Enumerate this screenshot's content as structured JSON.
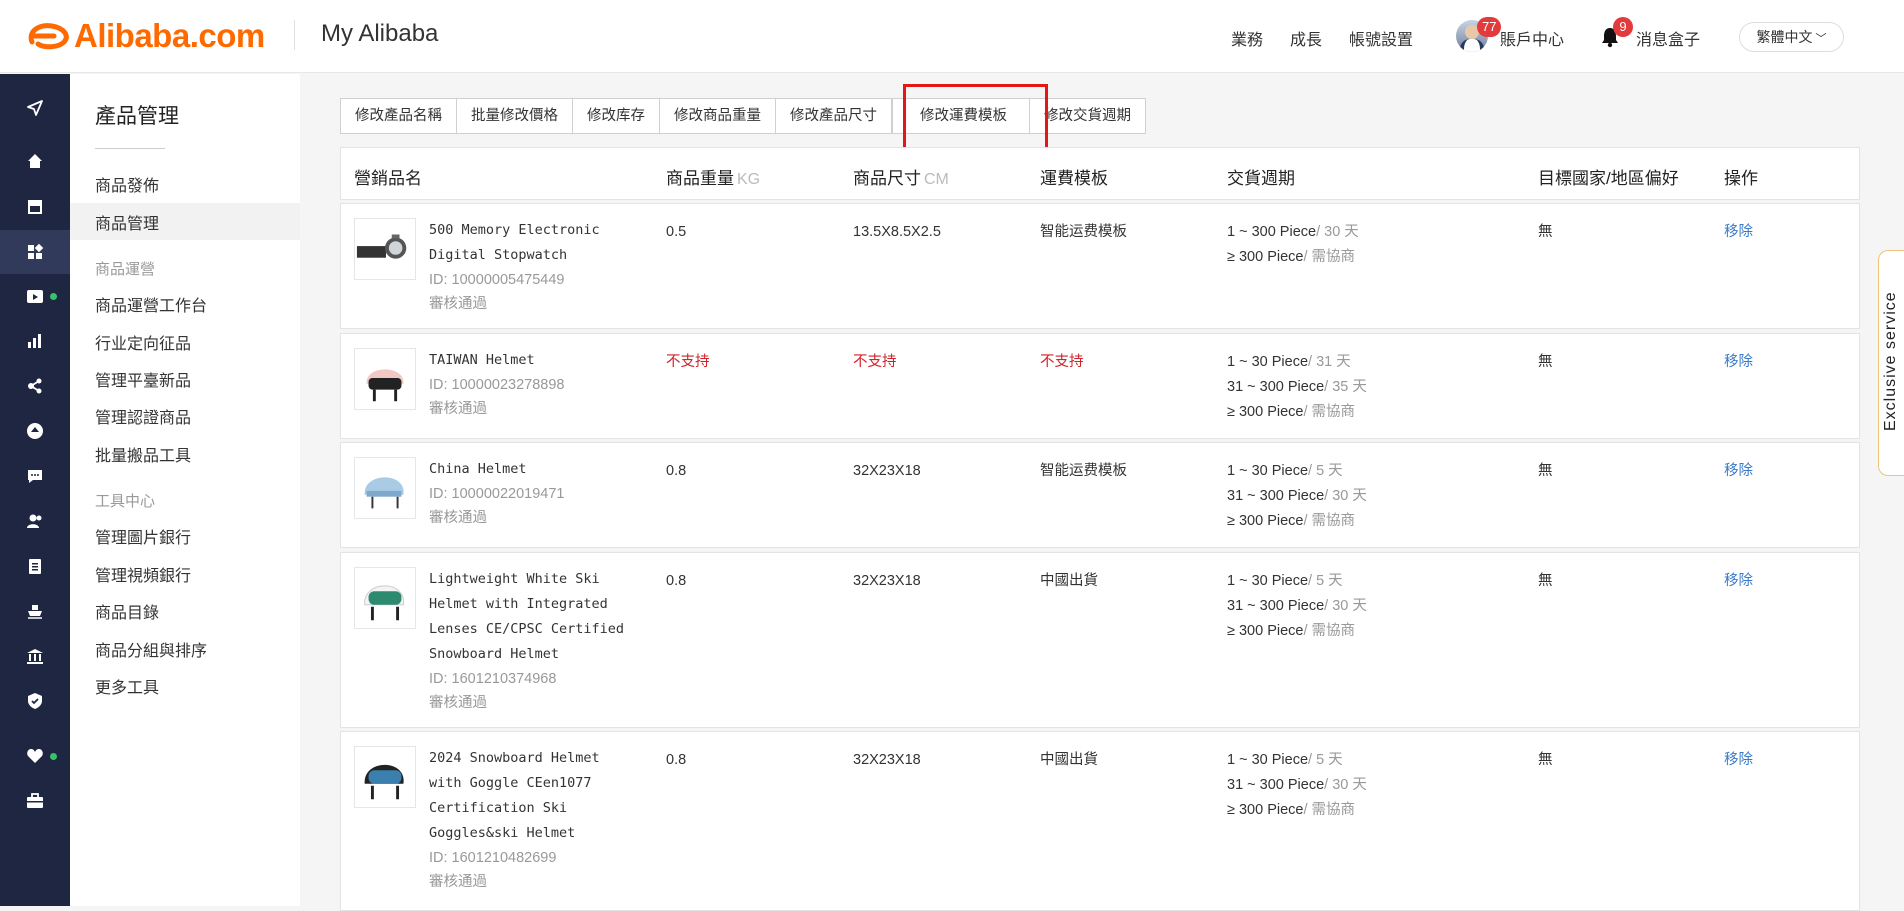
{
  "header": {
    "logo_text": "Alibaba.com",
    "title": "My Alibaba",
    "nav": [
      "業務",
      "成長",
      "帳號設置"
    ],
    "account_label": "賬戶中心",
    "account_badge": "77",
    "message_label": "消息盒子",
    "message_badge": "9",
    "language": "繁體中文"
  },
  "rail": {
    "icons": [
      "send-icon",
      "home-icon",
      "store-icon",
      "apps-icon",
      "video-icon",
      "bar-chart-icon",
      "share-icon",
      "upload-icon",
      "chat-icon",
      "users-icon",
      "clipboard-icon",
      "ship-icon",
      "bank-icon",
      "shield-icon",
      "heart-icon",
      "briefcase-icon"
    ],
    "active_icon": "apps-icon"
  },
  "sidebar": {
    "title": "產品管理",
    "items": [
      "商品發佈",
      "商品管理"
    ],
    "group1": "商品運營",
    "group1_items": [
      "商品運營工作台",
      "行业定向征品",
      "管理平臺新品",
      "管理認證商品",
      "批量搬品工具"
    ],
    "group2": "工具中心",
    "group2_items": [
      "管理圖片銀行",
      "管理視頻銀行",
      "商品目錄",
      "商品分組與排序",
      "更多工具"
    ],
    "active": "商品管理"
  },
  "tabs": [
    "修改產品名稱",
    "批量修改價格",
    "修改库存",
    "修改商品重量",
    "修改產品尺寸",
    "修改運費模板",
    "修改交貨週期"
  ],
  "highlighted_tab": "修改運費模板",
  "table": {
    "headers": {
      "name": "營銷品名",
      "weight": "商品重量",
      "weight_unit": "KG",
      "size": "商品尺寸",
      "size_unit": "CM",
      "shipping": "運費模板",
      "lead": "交貨週期",
      "country": "目標國家/地區偏好",
      "action": "操作"
    },
    "rows": [
      {
        "name_lines": [
          "500 Memory Electronic",
          "Digital Stopwatch"
        ],
        "id": "ID: 10000005475449",
        "status": "審核通過",
        "weight": "0.5",
        "size": "13.5X8.5X2.5",
        "shipping": "智能运费模板",
        "lead": [
          {
            "range": "1 ~ 300 Piece",
            "time": "/ 30 天"
          },
          {
            "range": "≥ 300 Piece",
            "time": "/ 需協商"
          }
        ],
        "country": "無",
        "action": "移除"
      },
      {
        "name_lines": [
          "TAIWAN Helmet"
        ],
        "id": "ID: 10000023278898",
        "status": "審核通過",
        "weight": "不支持",
        "size": "不支持",
        "shipping": "不支持",
        "lead": [
          {
            "range": "1 ~ 30 Piece",
            "time": "/ 31 天"
          },
          {
            "range": "31 ~ 300 Piece",
            "time": "/ 35 天"
          },
          {
            "range": "≥ 300 Piece",
            "time": "/ 需協商"
          }
        ],
        "country": "無",
        "action": "移除"
      },
      {
        "name_lines": [
          "China Helmet"
        ],
        "id": "ID: 10000022019471",
        "status": "審核通過",
        "weight": "0.8",
        "size": "32X23X18",
        "shipping": "智能运费模板",
        "lead": [
          {
            "range": "1 ~ 30 Piece",
            "time": "/ 5 天"
          },
          {
            "range": "31 ~ 300 Piece",
            "time": "/ 30 天"
          },
          {
            "range": "≥ 300 Piece",
            "time": "/ 需協商"
          }
        ],
        "country": "無",
        "action": "移除"
      },
      {
        "name_lines": [
          "Lightweight White Ski",
          "Helmet with Integrated",
          "Lenses CE/CPSC Certified",
          "Snowboard Helmet"
        ],
        "id": "ID: 1601210374968",
        "status": "審核通過",
        "weight": "0.8",
        "size": "32X23X18",
        "shipping": "中國出貨",
        "lead": [
          {
            "range": "1 ~ 30 Piece",
            "time": "/ 5 天"
          },
          {
            "range": "31 ~ 300 Piece",
            "time": "/ 30 天"
          },
          {
            "range": "≥ 300 Piece",
            "time": "/ 需協商"
          }
        ],
        "country": "無",
        "action": "移除"
      },
      {
        "name_lines": [
          "2024 Snowboard Helmet",
          "with Goggle CEen1077",
          "Certification Ski",
          "Goggles&ski Helmet"
        ],
        "id": "ID: 1601210482699",
        "status": "審核通過",
        "weight": "0.8",
        "size": "32X23X18",
        "shipping": "中國出貨",
        "lead": [
          {
            "range": "1 ~ 30 Piece",
            "time": "/ 5 天"
          },
          {
            "range": "31 ~ 300 Piece",
            "time": "/ 30 天"
          },
          {
            "range": "≥ 300 Piece",
            "time": "/ 需協商"
          }
        ],
        "country": "無",
        "action": "移除"
      }
    ]
  },
  "floating": {
    "label": "Exclusive service"
  },
  "colors": {
    "brand": "#ff6a00",
    "rail": "#1f2641",
    "highlight": "#e51616",
    "link": "#3a7ac8",
    "unsupported": "#d1222a"
  }
}
